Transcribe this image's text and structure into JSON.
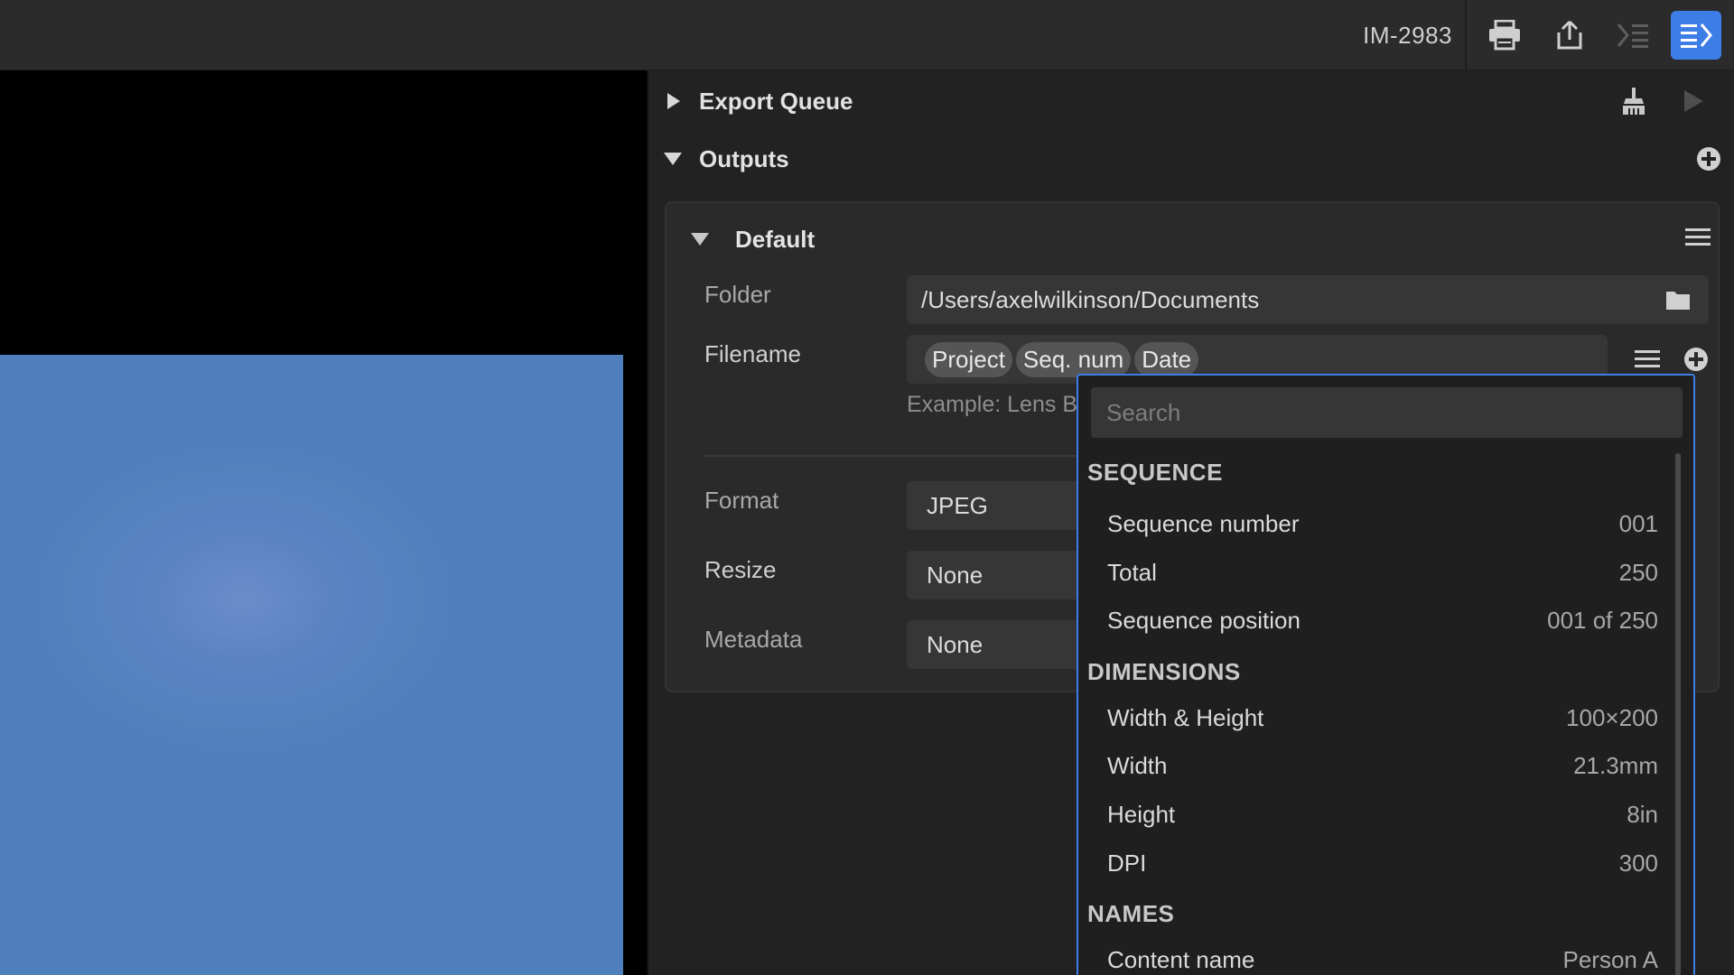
{
  "toolbar": {
    "doc_id": "IM-2983",
    "icons": [
      "print-icon",
      "share-icon",
      "left-panel-toggle-icon",
      "right-panel-toggle-icon"
    ],
    "accent": "#3d7de6"
  },
  "panel": {
    "export_queue": {
      "title": "Export Queue",
      "expanded": false
    },
    "outputs": {
      "title": "Outputs",
      "expanded": true
    },
    "preset": {
      "title": "Default",
      "folder_label": "Folder",
      "folder_value": "/Users/axelwilkinson/Documents",
      "filename_label": "Filename",
      "filename_tokens": [
        "Project",
        "Seq. num",
        "Date"
      ],
      "example_text": "Example: Lens Bl",
      "format_label": "Format",
      "format_value": "JPEG",
      "resize_label": "Resize",
      "resize_value": "None",
      "metadata_label": "Metadata",
      "metadata_value": "None"
    }
  },
  "token_menu": {
    "search_placeholder": "Search",
    "groups": [
      {
        "title": "SEQUENCE",
        "items": [
          {
            "name": "Sequence number",
            "value": "001"
          },
          {
            "name": "Total",
            "value": "250"
          },
          {
            "name": "Sequence position",
            "value": "001 of 250"
          }
        ]
      },
      {
        "title": "DIMENSIONS",
        "items": [
          {
            "name": "Width & Height",
            "value": "100×200"
          },
          {
            "name": "Width",
            "value": "21.3mm"
          },
          {
            "name": "Height",
            "value": "8in"
          },
          {
            "name": "DPI",
            "value": "300"
          }
        ]
      },
      {
        "title": "NAMES",
        "items": [
          {
            "name": "Content name",
            "value": "Person A"
          }
        ]
      }
    ]
  }
}
